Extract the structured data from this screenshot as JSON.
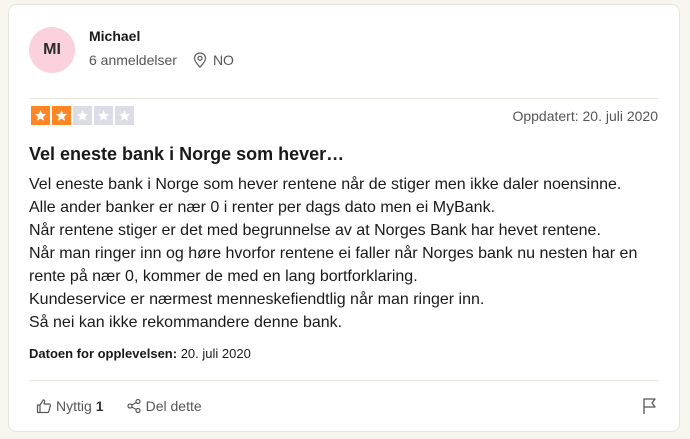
{
  "reviewer": {
    "initials": "MI",
    "name": "Michael",
    "reviews_count": "6 anmeldelser",
    "country": "NO",
    "avatar_color": "#fbd1dc"
  },
  "rating": {
    "value": 2,
    "max": 5,
    "on_color": "#ff8622",
    "off_color": "#dcdce6"
  },
  "date_label": "Oppdatert: 20. juli 2020",
  "review": {
    "title": "Vel eneste bank i Norge som hever…",
    "lines": [
      "Vel eneste bank i Norge som hever rentene når de stiger men ikke daler noensinne.",
      "Alle ander banker er nær 0 i renter per dags dato men ei MyBank.",
      "Når rentene stiger er det med begrunnelse av at Norges Bank har hevet rentene.",
      "Når man ringer inn og høre hvorfor rentene ei faller når Norges bank nu nesten har en rente på nær 0, kommer de med en lang bortforklaring.",
      "Kundeservice er nærmest menneskefiendtlig når man ringer inn.",
      "Så nei kan ikke rekommandere denne bank."
    ]
  },
  "experience": {
    "label": "Datoen for opplevelsen:",
    "date": "20. juli 2020"
  },
  "actions": {
    "useful_label": "Nyttig",
    "useful_count": "1",
    "share_label": "Del dette"
  },
  "icons": [
    "location-icon",
    "star-icon",
    "thumbs-up-icon",
    "share-icon",
    "flag-icon"
  ]
}
